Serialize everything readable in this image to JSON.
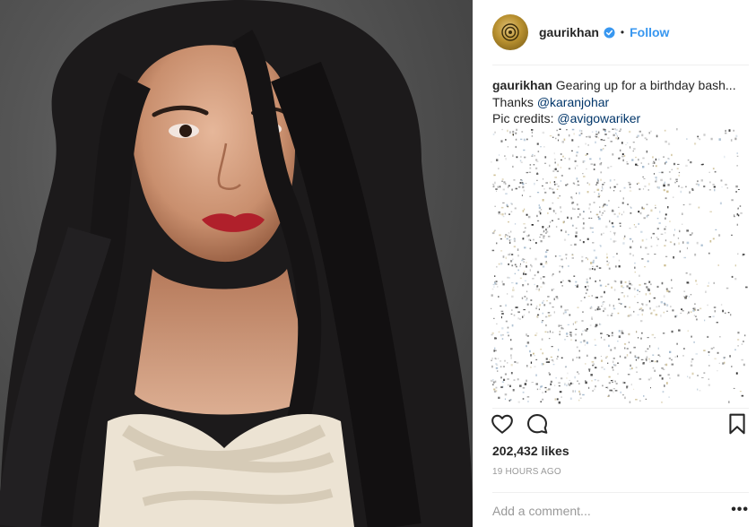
{
  "post": {
    "username": "gaurikhan",
    "follow_label": "Follow",
    "separator": "•",
    "caption": {
      "username": "gaurikhan",
      "line1": "Gearing up for a birthday bash...",
      "thanks_prefix": "Thanks ",
      "thanks_mention": "@karanjohar",
      "credits_prefix": "Pic credits: ",
      "credits_mention": "@avigowariker"
    },
    "likes": "202,432 likes",
    "timestamp": "19 HOURS AGO",
    "add_comment_placeholder": "Add a comment...",
    "more_label": "•••"
  },
  "colors": {
    "link": "#3897f0",
    "mention": "#003569",
    "verified": "#3897f0",
    "muted": "#999999"
  },
  "icons": [
    "verified-badge-icon",
    "heart-icon",
    "comment-icon",
    "bookmark-icon",
    "more-options-icon"
  ]
}
